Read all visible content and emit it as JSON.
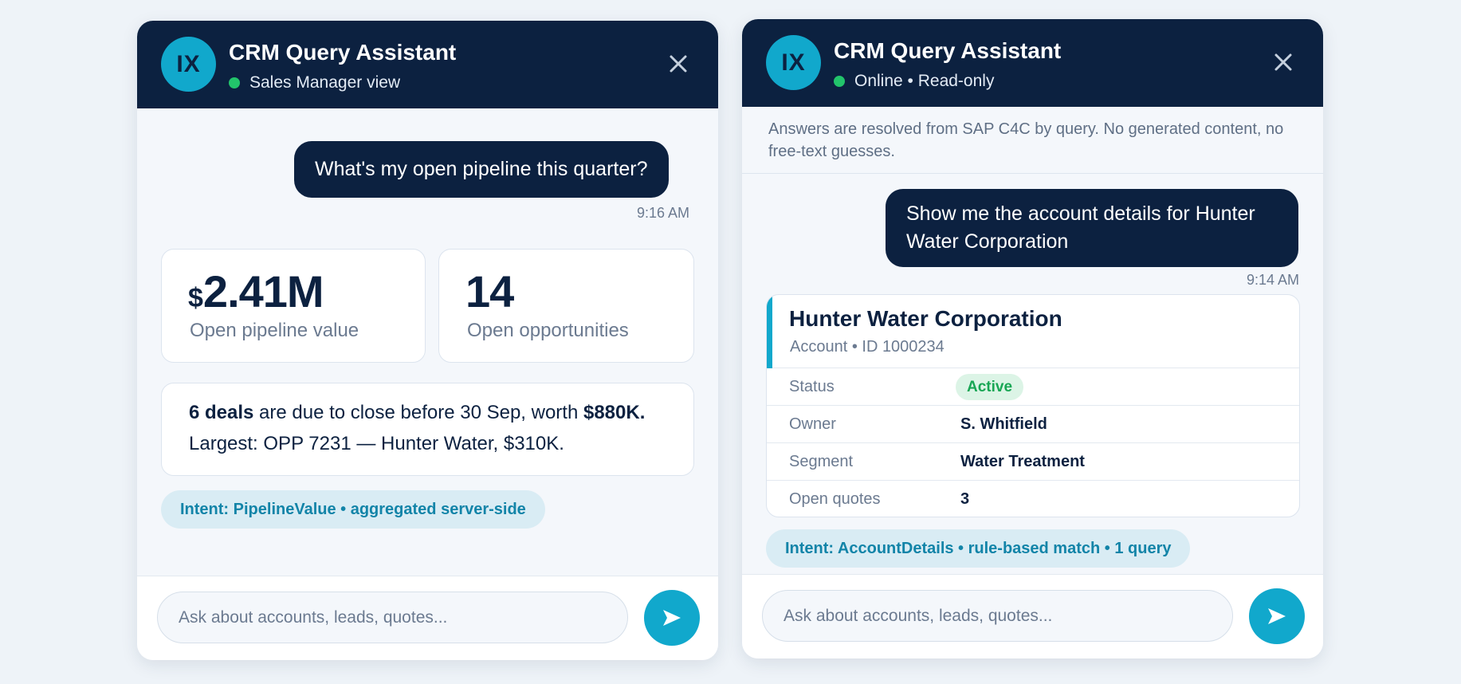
{
  "left_panel": {
    "header": {
      "avatar": "IX",
      "title": "CRM Query Assistant",
      "status": "Sales Manager view"
    },
    "user_message": "What's my open pipeline this quarter?",
    "user_time": "9:16 AM",
    "metrics": [
      {
        "currency": "$",
        "value": "2.41M",
        "caption": "Open pipeline value"
      },
      {
        "value": "14",
        "caption": "Open opportunities"
      }
    ],
    "summary": {
      "deals_bold": "6 deals",
      "text1": " are due to close before 30 Sep, worth ",
      "worth_bold": "$880K.",
      "line2": "Largest: OPP 7231 — Hunter Water, $310K."
    },
    "intent": "Intent: PipelineValue • aggregated server-side",
    "input_placeholder": "Ask about accounts, leads, quotes..."
  },
  "right_panel": {
    "header": {
      "avatar": "IX",
      "title": "CRM Query Assistant",
      "status": "Online • Read-only"
    },
    "notice": "Answers are resolved from SAP C4C by query. No generated content, no free-text guesses.",
    "user_message": "Show me the account details for Hunter Water Corporation",
    "user_time": "9:14 AM",
    "account": {
      "name": "Hunter Water Corporation",
      "subtitle": "Account • ID 1000234",
      "rows": [
        {
          "label": "Status",
          "value": "Active"
        },
        {
          "label": "Owner",
          "value": "S. Whitfield"
        },
        {
          "label": "Segment",
          "value": "Water Treatment"
        },
        {
          "label": "Open quotes",
          "value": "3"
        }
      ]
    },
    "intent": "Intent: AccountDetails • rule-based match • 1 query",
    "input_placeholder": "Ask about accounts, leads, quotes..."
  },
  "icons": {
    "close": "close-icon",
    "send": "send-icon",
    "online": "status-dot-icon"
  },
  "colors": {
    "header_bg": "#0c2140",
    "accent": "#11a8cc",
    "online": "#22c46b",
    "active_badge": "#18a654"
  }
}
